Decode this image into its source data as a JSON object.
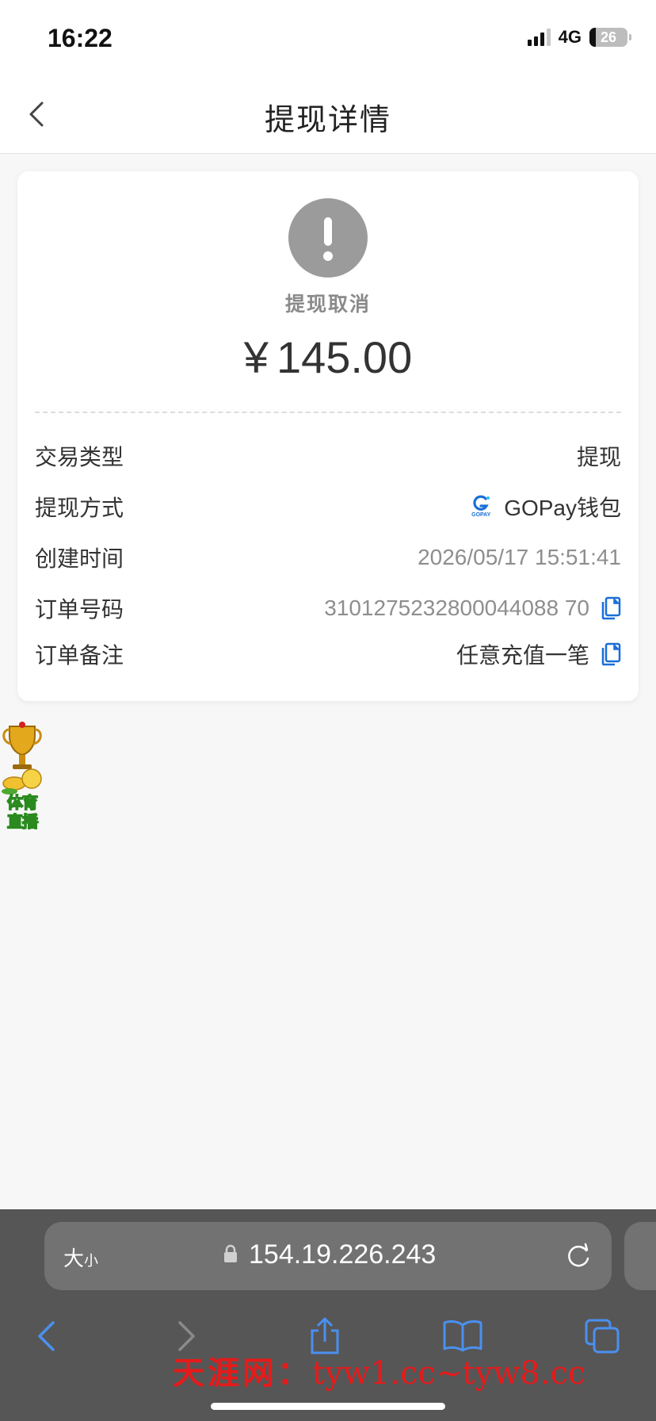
{
  "status_bar": {
    "time": "16:22",
    "network": "4G",
    "battery": "26"
  },
  "nav": {
    "title": "提现详情"
  },
  "detail": {
    "status": "提现取消",
    "currency": "¥",
    "amount": "145.00",
    "rows": [
      {
        "label": "交易类型",
        "value": "提现"
      },
      {
        "label": "提现方式",
        "value": "GOPay钱包",
        "logo_caption": "GOPAY"
      },
      {
        "label": "创建时间",
        "value": "2026/05/17 15:51:41"
      },
      {
        "label": "订单号码",
        "value": "3101275232800044088 70"
      },
      {
        "label": "订单备注",
        "value": "任意充值一笔"
      }
    ]
  },
  "floating_badge": {
    "line1": "体育",
    "line2": "直播"
  },
  "browser": {
    "size_label_big": "大",
    "size_label_small": "小",
    "url": "154.19.226.243"
  },
  "watermark": {
    "cn": "天涯网：",
    "en": "tyw1.cc~tyw8.cc"
  },
  "colors": {
    "accent_blue": "#1a6fd8",
    "status_gray": "#9b9b9b",
    "watermark_red": "#e51b1b"
  },
  "icons": [
    "back-chevron-icon",
    "exclamation-icon",
    "gopay-logo-icon",
    "copy-icon",
    "lock-icon",
    "reload-icon",
    "share-icon",
    "bookmarks-icon",
    "tabs-icon"
  ]
}
